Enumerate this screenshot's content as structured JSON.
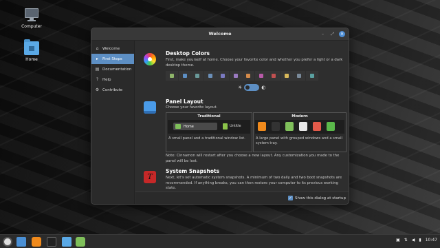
{
  "desktop": {
    "icons": [
      {
        "label": "Computer",
        "icon": "computer-icon"
      },
      {
        "label": "Home",
        "icon": "home-folder-icon"
      }
    ]
  },
  "window": {
    "title": "Welcome",
    "controls": {
      "minimize": "–",
      "maximize": "⤢",
      "close": "✕"
    }
  },
  "sidebar": {
    "items": [
      {
        "label": "Welcome",
        "icon": "home-icon",
        "glyph": "⌂",
        "active": false
      },
      {
        "label": "First Steps",
        "icon": "first-steps-icon",
        "glyph": "▸",
        "active": true
      },
      {
        "label": "Documentation",
        "icon": "documentation-icon",
        "glyph": "▤",
        "active": false
      },
      {
        "label": "Help",
        "icon": "help-icon",
        "glyph": "?",
        "active": false
      },
      {
        "label": "Contribute",
        "icon": "contribute-icon",
        "glyph": "⚙",
        "active": false
      }
    ]
  },
  "desktop_colors": {
    "title": "Desktop Colors",
    "text": "First, make yourself at home. Choose your favorite color and whether you prefer a light or a dark desktop theme.",
    "swatch_colors": [
      "#8fb56a",
      "#5d8fc4",
      "#6a9a9a",
      "#6b8fb8",
      "#7a7ac0",
      "#9a7ac0",
      "#d48a4a",
      "#b85aa8",
      "#c05050",
      "#d8b85a",
      "#7a8a9a",
      "#5aa0a0"
    ],
    "theme_toggle": {
      "light_icon": "☀",
      "dark_icon": "◐",
      "dark_enabled": true
    }
  },
  "panel_layout": {
    "title": "Panel Layout",
    "text": "Choose your favorite layout.",
    "traditional": {
      "heading": "Traditional",
      "preview_label": "Home",
      "preview_window": "Untitle",
      "description": "A small panel and a traditional window list."
    },
    "modern": {
      "heading": "Modern",
      "description": "A large panel with grouped windows and a small system tray.",
      "app_colors": [
        "#f08a1c",
        "#333333",
        "#7fbf5a",
        "#e8e8e8",
        "#e25a4a",
        "#5ab84a"
      ]
    },
    "note": "Note: Cinnamon will restart after you choose a new layout. Any customization you made to the panel will be lost."
  },
  "system_snapshots": {
    "title": "System Snapshots",
    "text": "Next, let's set automatic system snapshots. A minimum of two daily and two boot snapshots are recommended. If anything breaks, you can then restore your computer to its previous working state."
  },
  "footer": {
    "checkbox_label": "Show this dialog at startup",
    "checked": true
  },
  "taskbar": {
    "clock": "10:47",
    "tray_icons": [
      "network-icon",
      "volume-icon",
      "battery-icon",
      "printer-icon"
    ]
  }
}
